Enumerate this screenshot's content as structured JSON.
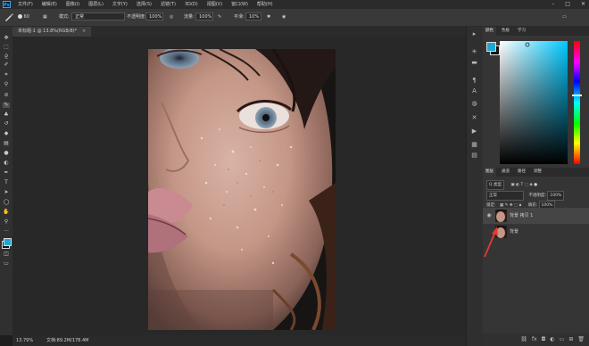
{
  "app": {
    "logo": "Ps"
  },
  "menubar": {
    "items": [
      "文件(F)",
      "编辑(E)",
      "图像(I)",
      "图层(L)",
      "文字(Y)",
      "选择(S)",
      "滤镜(T)",
      "3D(D)",
      "视图(V)",
      "窗口(W)",
      "帮助(H)"
    ],
    "window_controls": {
      "minimize": "–",
      "maximize": "□",
      "close": "✕"
    }
  },
  "options": {
    "brush_size": "60",
    "mode_label": "模式:",
    "mode_value": "正常",
    "opacity_label": "不透明度:",
    "opacity_value": "100%",
    "flow_label": "流量:",
    "flow_value": "100%",
    "smoothing_label": "平滑:",
    "smoothing_value": "10%"
  },
  "document": {
    "tab_title": "未标题-1 @ 13.8%(RGB/8)",
    "tab_modified": "*",
    "tab_close": "×"
  },
  "status": {
    "zoom": "13.79%",
    "doc": "文档:89.2M/178.4M"
  },
  "panels": {
    "color_tabs": [
      "颜色",
      "色板",
      "学习"
    ],
    "layer_tabs": [
      "图层",
      "通道",
      "路径",
      "调整"
    ],
    "filter_label": "Q 类型",
    "blend_mode": "正常",
    "opacity_label": "不透明度:",
    "opacity_value": "100%",
    "lock_label": "锁定:",
    "fill_label": "填充:",
    "fill_value": "100%",
    "layers": [
      {
        "name": "背景 拷贝 1",
        "visible": true
      },
      {
        "name": "背景",
        "visible": false
      }
    ],
    "footer_icons": [
      "link-icon",
      "fx-icon",
      "mask-icon",
      "adjustment-icon",
      "folder-icon",
      "new-layer-icon",
      "trash-icon"
    ]
  },
  "colors": {
    "foreground": "#1ea7cf",
    "background": "#111111",
    "hue": "#00c8ff",
    "annotation_arrow": "#e33a2e"
  }
}
